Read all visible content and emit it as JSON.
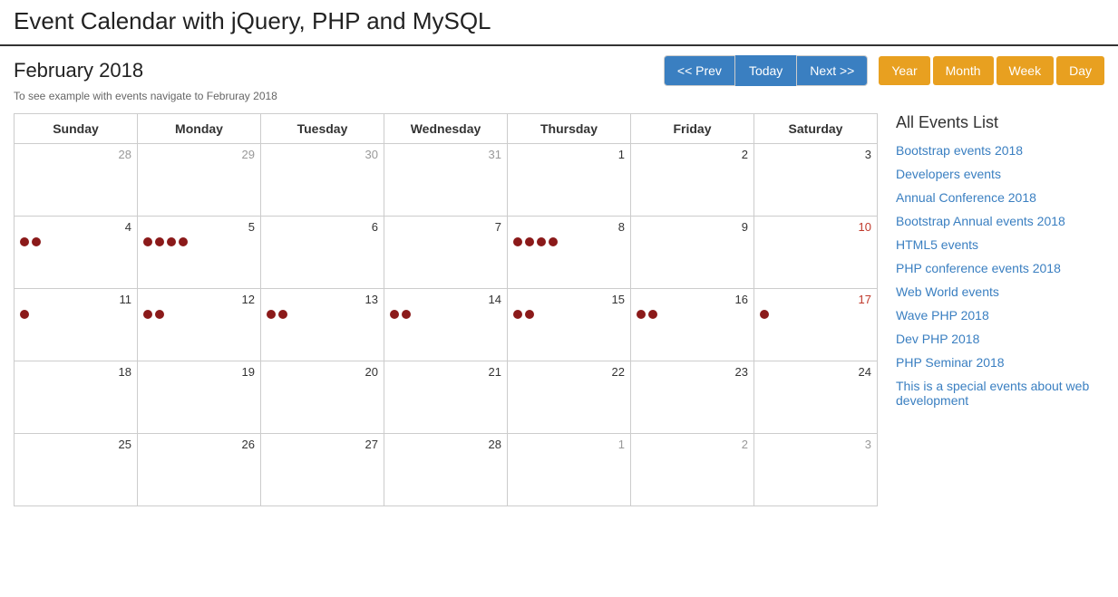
{
  "page": {
    "title": "Event Calendar with jQuery, PHP and MySQL",
    "subtitle": "To see example with events navigate to Februray 2018"
  },
  "header": {
    "month_title": "February 2018",
    "prev_label": "<< Prev",
    "today_label": "Today",
    "next_label": "Next >>",
    "view_year": "Year",
    "view_month": "Month",
    "view_week": "Week",
    "view_day": "Day"
  },
  "sidebar": {
    "title": "All Events List",
    "events": [
      "Bootstrap events 2018",
      "Developers events",
      "Annual Conference 2018",
      "Bootstrap Annual events 2018",
      "HTML5 events",
      "PHP conference events 2018",
      "Web World events",
      "Wave PHP 2018",
      "Dev PHP 2018",
      "PHP Seminar 2018",
      "This is a special events about web development"
    ]
  },
  "calendar": {
    "days_of_week": [
      "Sunday",
      "Monday",
      "Tuesday",
      "Wednesday",
      "Thursday",
      "Friday",
      "Saturday"
    ],
    "weeks": [
      [
        {
          "num": "28",
          "in_month": false,
          "dots": 0
        },
        {
          "num": "29",
          "in_month": false,
          "dots": 0
        },
        {
          "num": "30",
          "in_month": false,
          "dots": 0
        },
        {
          "num": "31",
          "in_month": false,
          "dots": 0
        },
        {
          "num": "1",
          "in_month": true,
          "dots": 0
        },
        {
          "num": "2",
          "in_month": true,
          "dots": 0
        },
        {
          "num": "3",
          "in_month": true,
          "dots": 0,
          "saturday": false
        }
      ],
      [
        {
          "num": "4",
          "in_month": true,
          "dots": 2
        },
        {
          "num": "5",
          "in_month": true,
          "dots": 4
        },
        {
          "num": "6",
          "in_month": true,
          "dots": 0
        },
        {
          "num": "7",
          "in_month": true,
          "dots": 0
        },
        {
          "num": "8",
          "in_month": true,
          "dots": 4
        },
        {
          "num": "9",
          "in_month": true,
          "dots": 0
        },
        {
          "num": "10",
          "in_month": true,
          "dots": 0,
          "saturday": true
        }
      ],
      [
        {
          "num": "11",
          "in_month": true,
          "dots": 1
        },
        {
          "num": "12",
          "in_month": true,
          "dots": 2
        },
        {
          "num": "13",
          "in_month": true,
          "dots": 2
        },
        {
          "num": "14",
          "in_month": true,
          "dots": 2
        },
        {
          "num": "15",
          "in_month": true,
          "dots": 2
        },
        {
          "num": "16",
          "in_month": true,
          "dots": 2
        },
        {
          "num": "17",
          "in_month": true,
          "dots": 1,
          "saturday": true
        }
      ],
      [
        {
          "num": "18",
          "in_month": true,
          "dots": 0
        },
        {
          "num": "19",
          "in_month": true,
          "dots": 0
        },
        {
          "num": "20",
          "in_month": true,
          "dots": 0
        },
        {
          "num": "21",
          "in_month": true,
          "dots": 0
        },
        {
          "num": "22",
          "in_month": true,
          "dots": 0
        },
        {
          "num": "23",
          "in_month": true,
          "dots": 0
        },
        {
          "num": "24",
          "in_month": true,
          "dots": 0,
          "saturday": false
        }
      ],
      [
        {
          "num": "25",
          "in_month": true,
          "dots": 0
        },
        {
          "num": "26",
          "in_month": true,
          "dots": 0
        },
        {
          "num": "27",
          "in_month": true,
          "dots": 0
        },
        {
          "num": "28",
          "in_month": true,
          "dots": 0
        },
        {
          "num": "1",
          "in_month": false,
          "dots": 0
        },
        {
          "num": "2",
          "in_month": false,
          "dots": 0
        },
        {
          "num": "3",
          "in_month": false,
          "dots": 0
        }
      ]
    ]
  }
}
